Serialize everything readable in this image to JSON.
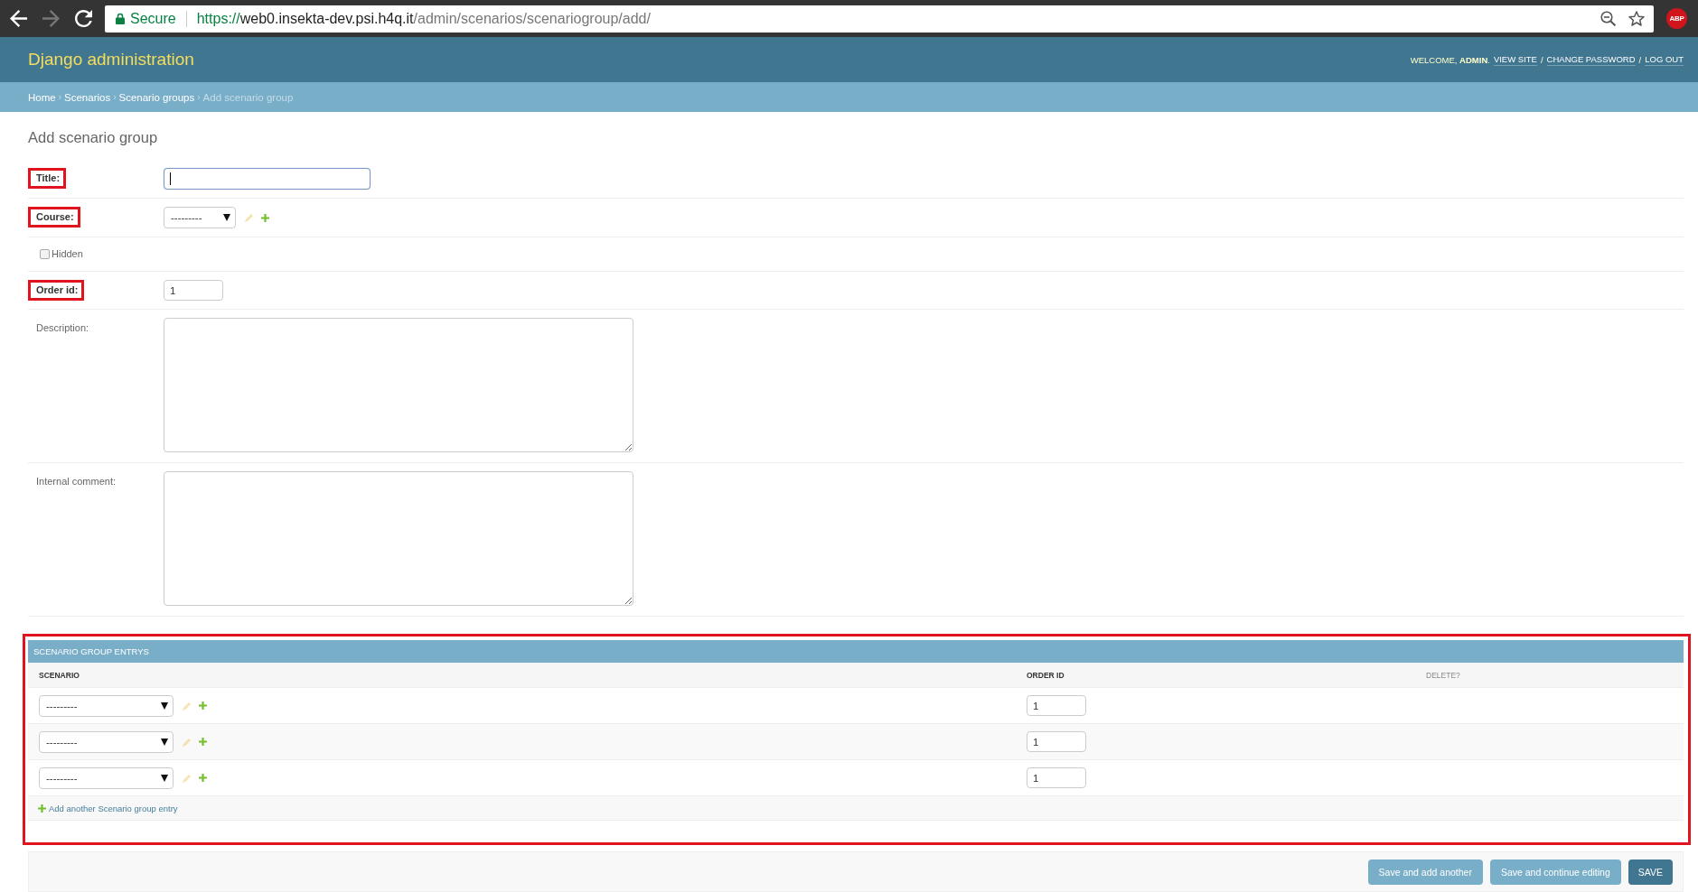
{
  "browser": {
    "nav": [
      {
        "kind": "back",
        "disabled": false
      },
      {
        "kind": "forward",
        "disabled": true
      },
      {
        "kind": "reload",
        "disabled": false
      }
    ],
    "security_label": "Secure",
    "url": {
      "scheme": "https://",
      "host": "web0.insekta-dev.psi.h4q.it",
      "path": "/admin/scenarios/scenariogroup/add/"
    },
    "extension_badge": "ABP"
  },
  "header": {
    "title": "Django administration",
    "user_tools": [
      {
        "kind": "greeting",
        "text": "WELCOME, **ADMIN**."
      },
      {
        "kind": "link",
        "text": "VIEW SITE"
      },
      {
        "kind": "separator",
        "text": "/"
      },
      {
        "kind": "link",
        "text": "CHANGE PASSWORD"
      },
      {
        "kind": "separator",
        "text": "/"
      },
      {
        "kind": "link",
        "text": "LOG OUT"
      }
    ]
  },
  "breadcrumbs": [
    {
      "kind": "link",
      "text": "Home"
    },
    {
      "kind": "separator",
      "text": "›"
    },
    {
      "kind": "link",
      "text": "Scenarios"
    },
    {
      "kind": "separator",
      "text": "›"
    },
    {
      "kind": "link",
      "text": "Scenario groups"
    },
    {
      "kind": "separator",
      "text": "›"
    },
    {
      "kind": "current",
      "text": "Add scenario group"
    }
  ],
  "page_title": "Add scenario group",
  "fields": [
    {
      "kind": "text",
      "label": "Title:",
      "required": true,
      "highlighted": true,
      "focused": true
    },
    {
      "kind": "select",
      "label": "Course:",
      "required": true,
      "highlighted": true,
      "value": "---------",
      "edit_disabled": true
    },
    {
      "kind": "checkbox",
      "label": "Hidden",
      "required": false,
      "highlighted": false,
      "checked": false
    },
    {
      "kind": "number",
      "label": "Order id:",
      "required": true,
      "highlighted": true,
      "value": "1"
    },
    {
      "kind": "textarea",
      "label": "Description:",
      "required": false,
      "highlighted": false
    },
    {
      "kind": "textarea",
      "label": "Internal comment:",
      "required": false,
      "highlighted": false
    }
  ],
  "inline": {
    "title": "SCENARIO GROUP ENTRYS",
    "highlighted": true,
    "columns": [
      "SCENARIO",
      "ORDER ID",
      "DELETE?"
    ],
    "rows": [
      {
        "scenario": "---------",
        "order_id": "1",
        "edit_disabled": true
      },
      {
        "scenario": "---------",
        "order_id": "1",
        "edit_disabled": true
      },
      {
        "scenario": "---------",
        "order_id": "1",
        "edit_disabled": true
      }
    ],
    "add_link": "Add another Scenario group entry"
  },
  "submit_buttons": [
    {
      "kind": "secondary",
      "label": "Save and add another"
    },
    {
      "kind": "secondary",
      "label": "Save and continue editing"
    },
    {
      "kind": "default",
      "label": "SAVE"
    }
  ]
}
